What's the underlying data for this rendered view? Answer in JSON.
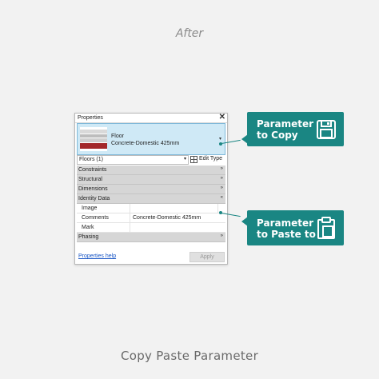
{
  "header": {
    "after_label": "After"
  },
  "caption": "Copy Paste Parameter",
  "panel": {
    "title": "Properties",
    "close_glyph": "✕",
    "type_selector": {
      "family": "Floor",
      "type": "Concrete-Domestic 425mm",
      "arrow": "▾"
    },
    "instance": {
      "label": "Floors (1)",
      "arrow": "▾",
      "edit_type": "Edit Type"
    },
    "categories": {
      "constraints": "Constraints",
      "structural": "Structural",
      "dimensions": "Dimensions",
      "identity_data": "Identity Data",
      "phasing": "Phasing"
    },
    "chevron_collapsed": "»",
    "chevron_expanded": "«",
    "params": {
      "image": {
        "name": "Image",
        "value": ""
      },
      "comments": {
        "name": "Comments",
        "value": "Concrete-Domestic 425mm"
      },
      "mark": {
        "name": "Mark",
        "value": ""
      }
    },
    "help_link": "Properties help",
    "apply_button": "Apply"
  },
  "callouts": {
    "copy": {
      "line1": "Parameter",
      "line2": "to Copy",
      "icon": "save-icon"
    },
    "paste": {
      "line1": "Parameter",
      "line2": "to Paste to",
      "icon": "clipboard-icon"
    }
  },
  "colors": {
    "accent": "#1a8683",
    "selection": "#cfe9f6",
    "category_bg": "#d6d6d6",
    "material": "#a3282b",
    "link": "#1a57c6"
  }
}
